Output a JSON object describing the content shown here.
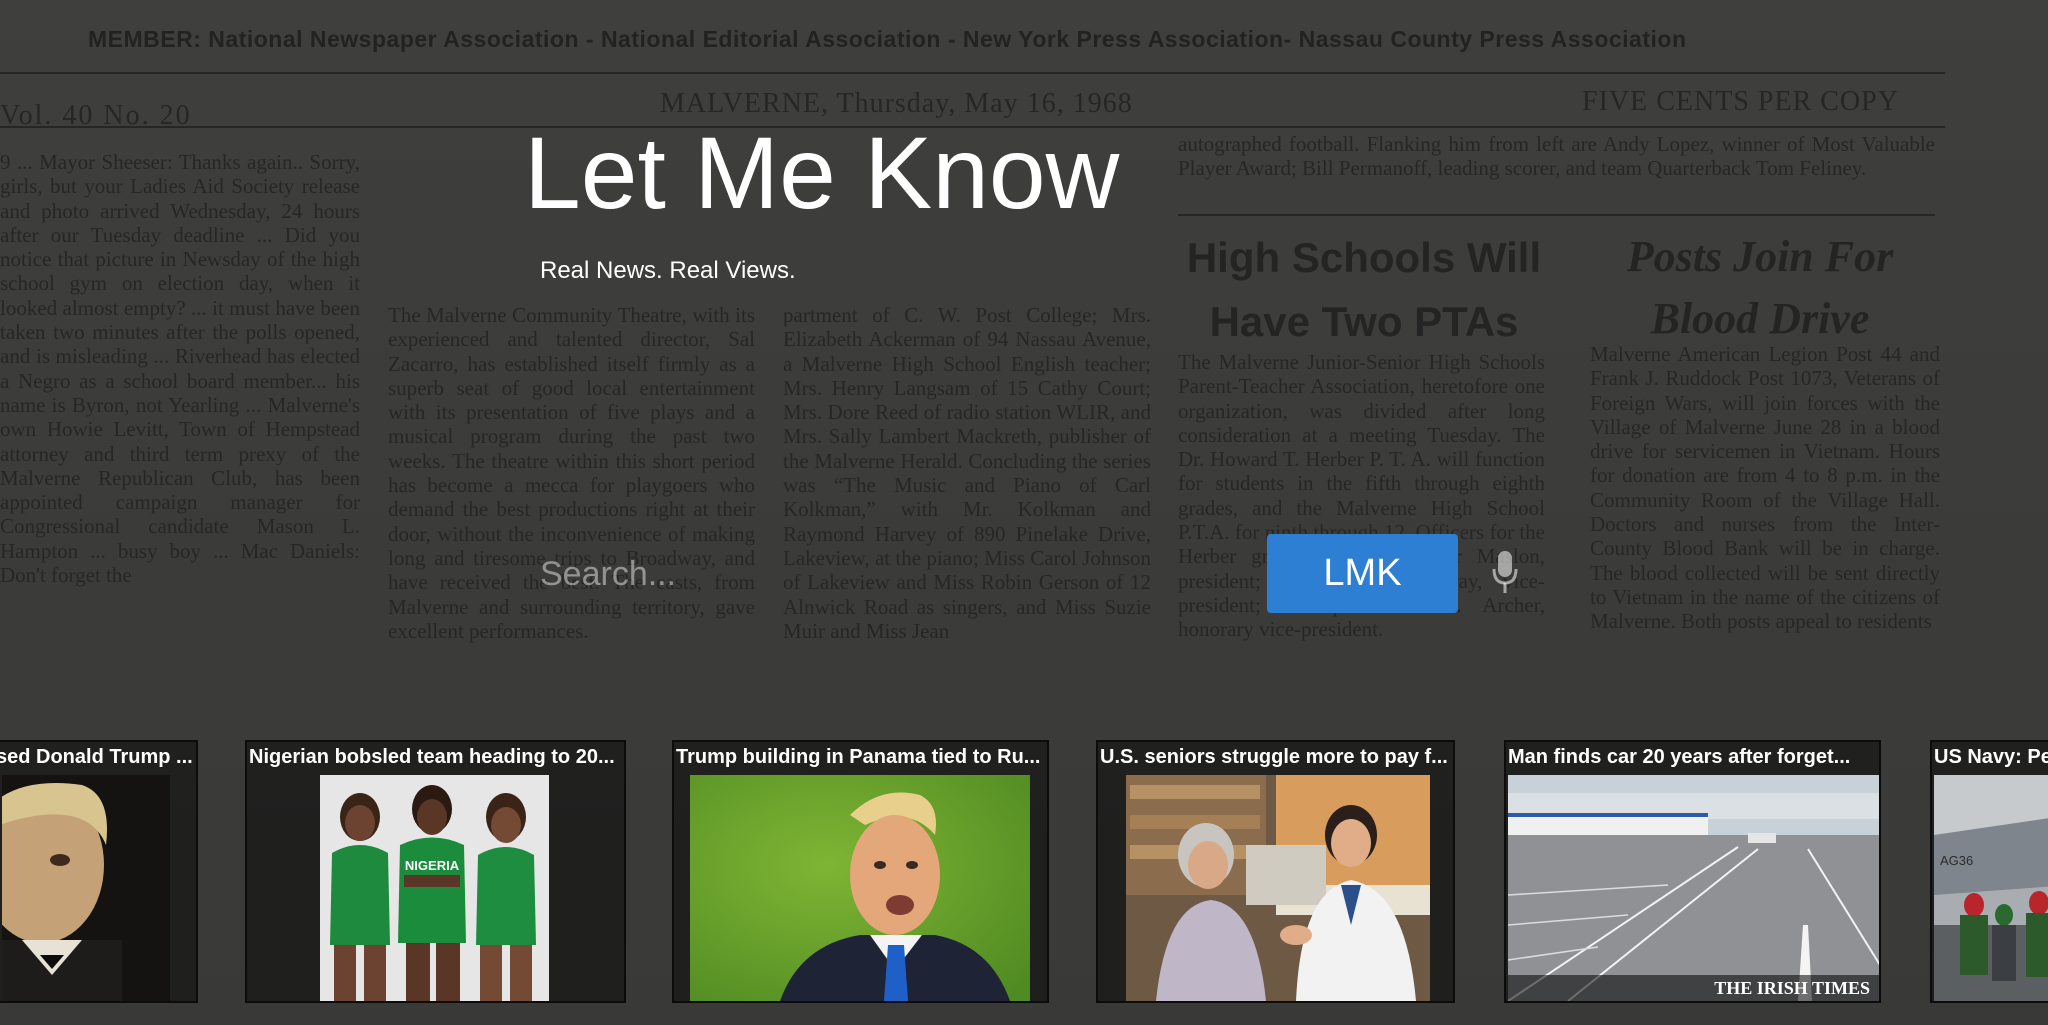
{
  "background": {
    "member_line": "MEMBER: National Newspaper Association - National Editorial Association - New York Press Association- Nassau County Press Association",
    "volume": "Vol. 40 No. 20",
    "dateline": "MALVERNE, Thursday, May 16, 1968",
    "price": "FIVE CENTS PER COPY",
    "headline_1_line1": "High Schools Will",
    "headline_1_line2": "Have Two PTAs",
    "headline_2_line1": "Posts Join For",
    "headline_2_line2": "Blood Drive",
    "col_left": "9 ... Mayor Sheeser: Thanks again.. Sorry, girls, but your Ladies Aid Society release and photo arrived Wednesday, 24 hours after our Tuesday deadline ... Did you notice that picture in Newsday of the high school gym on election day, when it looked almost empty? ... it must have been taken two minutes after the polls opened, and is misleading ... Riverhead has elected a Negro as a school board member... his name is Byron, not Yearling ... Malverne's own Howie Levitt, Town of Hempstead attorney and third term prexy of the Malverne Republican Club, has been appointed campaign manager for Congressional candidate Mason L. Hampton ... busy boy ... Mac Daniels: Don't forget the",
    "col_mid1": "The Malverne Community Theatre, with its experienced and talented director, Sal Zacarro, has established itself firmly as a superb seat of good local entertainment with its presentation of five plays and a musical program during the past two weeks. The theatre within this short period has become a mecca for playgoers who demand the best productions right at their door, without the inconvenience of making long and tiresome trips to Broadway, and have received the best. The casts, from Malverne and surrounding territory, gave excellent performances.",
    "col_mid2": "partment of C. W. Post College; Mrs. Elizabeth Ackerman of 94 Nassau Avenue, a Malverne High School English teacher; Mrs. Henry Langsam of 15 Cathy Court; Mrs. Dore Reed of radio station WLIR, and Mrs. Sally Lambert Mackreth, publisher of the Malverne Herald. Concluding the series was “The Music and Piano of Carl Kolkman,” with Mr. Kolkman and Raymond Harvey of 890 Pinelake Drive, Lakeview, at the piano; Miss Carol Johnson of Lakeview and Miss Robin Gerson of 12 Alnwick Road as singers, and Miss Suzie Muir and Miss Jean",
    "col_top_right": "autographed football. Flanking him from left are Andy Lopez, winner of Most Valuable Player Award; Bill Permanoff, leading scorer, and team Quarterback Tom Feliney.",
    "col_r1": "The Malverne Junior-Senior High Schools Parent-Teacher Association, heretofore one organization, was divided after long consideration at a meeting Tuesday. The Dr. Howard T. Herber P. T. A. will function for students in the fifth through eighth grades, and the Malverne High School P.T.A. for ninth through 12. Officers for the Herber group are Mrs. Elinor Maslon, president; Mrs. Joyce McCray, vice-president; Principal John K. Archer, honorary vice-president.",
    "col_r2": "Malverne American Legion Post 44 and Frank J. Ruddock Post 1073, Veterans of Foreign Wars, will join forces with the Village of Malverne June 28 in a blood drive for servicemen in Vietnam. Hours for donation are from 4 to 8 p.m. in the Community Room of the Village Hall. Doctors and nurses from the Inter-County Blood Bank will be in charge. The blood collected will be sent directly to Vietnam in the name of the citizens of Malverne. Both posts appeal to residents"
  },
  "hero": {
    "title": "Let Me Know",
    "tagline": "Real News. Real Views.",
    "search_placeholder": "Search...",
    "search_value": "",
    "submit_label": "LMK"
  },
  "news": [
    {
      "title": "sed Donald Trump ...",
      "image": "man-in-tuxedo-photo"
    },
    {
      "title": "Nigerian bobsled team heading to 20...",
      "image": "three-athletes-in-green-photo"
    },
    {
      "title": "Trump building in Panama tied to Ru...",
      "image": "trump-portrait-photo"
    },
    {
      "title": "U.S. seniors struggle more to pay f...",
      "image": "pharmacist-with-senior-photo"
    },
    {
      "title": "Man finds car 20 years after forget...",
      "image": "airport-parking-lot-photo",
      "watermark": "THE IRISH TIMES"
    },
    {
      "title": "US Navy: Pe",
      "image": "navy-aircraft-carrier-photo"
    }
  ],
  "colors": {
    "button": "#2d7fd4",
    "text": "#ffffff",
    "overlay": "#3f3f3f"
  }
}
